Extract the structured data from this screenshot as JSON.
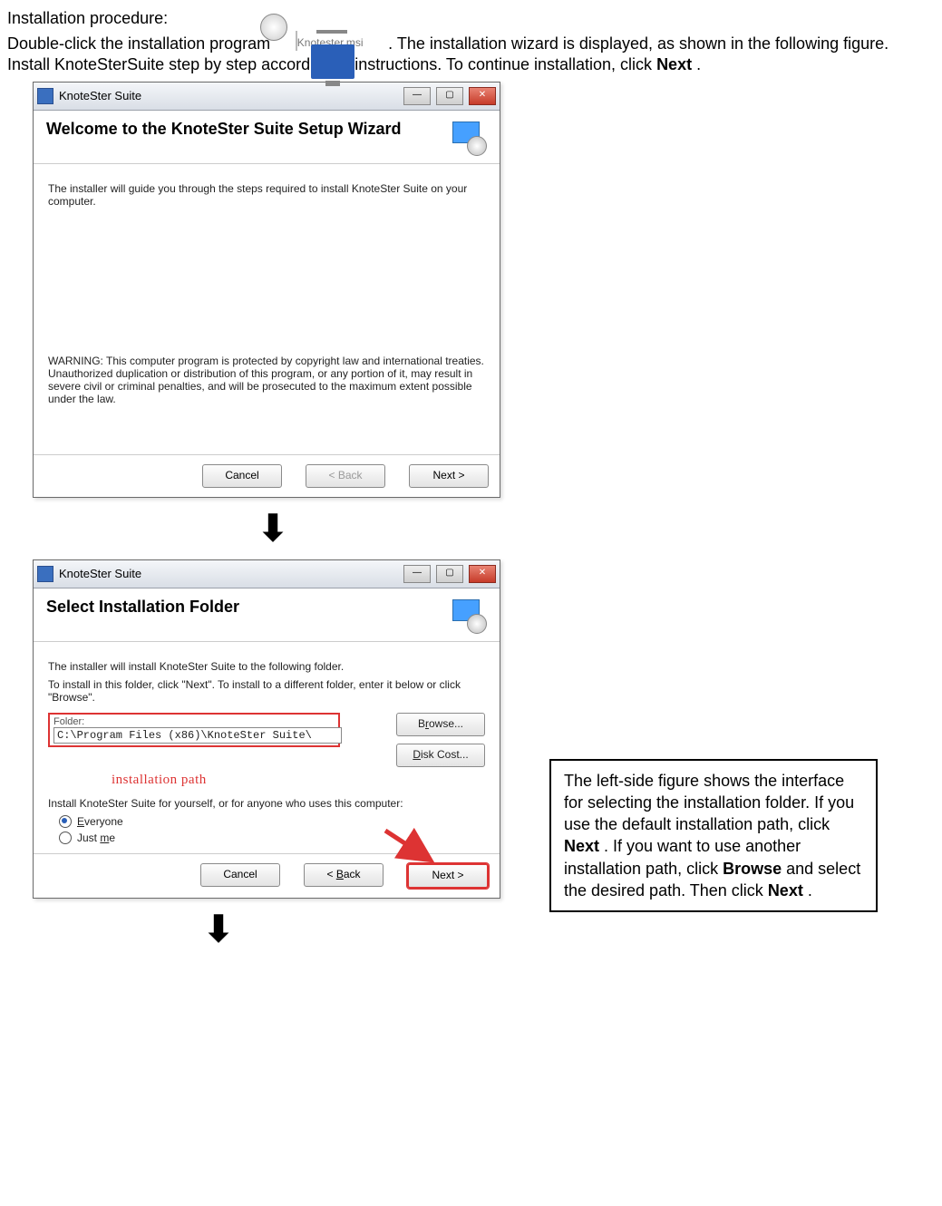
{
  "doc": {
    "heading": "Installation procedure:",
    "msi_filename": "Knotester.msi",
    "para1_a": "Double-click the installation program ",
    "para1_b": " . The installation wizard is displayed, as shown in the following figure. Install KnoteSterSuite step by step according to instructions. To continue installation, click ",
    "para1_next": "Next",
    "para1_c": "."
  },
  "wiz1": {
    "title": "KnoteSter Suite",
    "heading": "Welcome to the KnoteSter Suite Setup Wizard",
    "body1": "The installer will guide you through the steps required to install KnoteSter Suite on your computer.",
    "warn": "WARNING: This computer program is protected by copyright law and international treaties. Unauthorized duplication or distribution of this program, or any portion of it, may result in severe civil or criminal penalties, and will be prosecuted to the maximum extent possible under the law.",
    "btn_cancel": "Cancel",
    "btn_back": "< Back",
    "btn_next": "Next >"
  },
  "wiz2": {
    "title": "KnoteSter Suite",
    "heading": "Select Installation Folder",
    "body1": "The installer will install KnoteSter Suite to the following folder.",
    "body2": "To install in this folder, click \"Next\". To install to a different folder, enter it below or click \"Browse\".",
    "folder_label": "Folder:",
    "folder_value": "C:\\Program Files (x86)\\KnoteSter Suite\\",
    "btn_browse": "Browse...",
    "btn_diskcost": "Disk Cost...",
    "install_path_caption": "installation path",
    "scope_prompt": "Install KnoteSter Suite for yourself, or for anyone who uses this computer:",
    "opt_everyone": "Everyone",
    "opt_justme": "Just me",
    "btn_cancel": "Cancel",
    "btn_back": "< Back",
    "btn_next": "Next >"
  },
  "callout": {
    "t1": "The left-side figure shows the interface for selecting the installation folder. If you use the default installation path, click ",
    "b1": "Next",
    "t2": ". If you want to use another installation path, click ",
    "b2": "Browse",
    "t3": " and select the desired path. Then click ",
    "b3": "Next",
    "t4": "."
  },
  "arrow_glyph": "⬇"
}
